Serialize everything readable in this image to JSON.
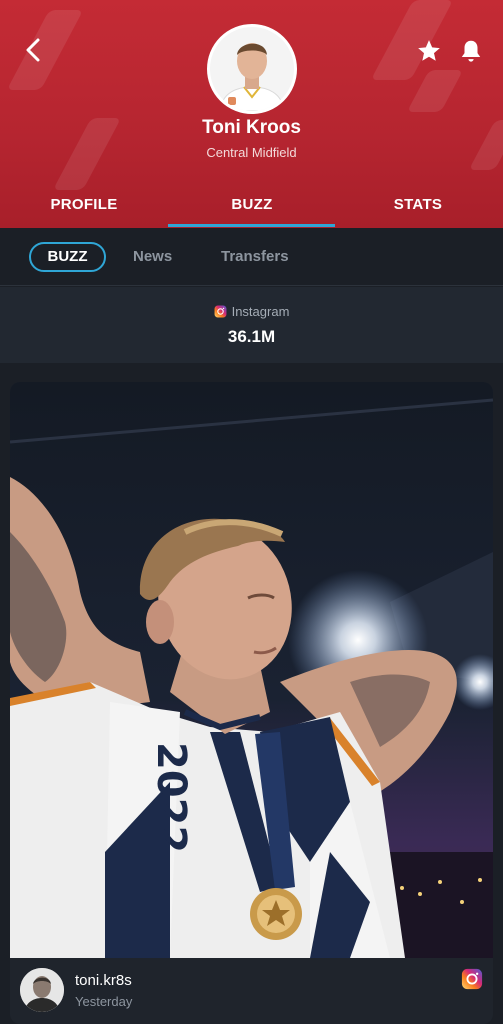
{
  "header": {
    "player_name": "Toni Kroos",
    "position": "Central Midfield",
    "colors": {
      "background": "#c42b35",
      "accent": "#2fa6d6"
    }
  },
  "tabs": [
    {
      "label": "PROFILE"
    },
    {
      "label": "BUZZ"
    },
    {
      "label": "STATS"
    }
  ],
  "active_tab": "BUZZ",
  "subtabs": [
    {
      "label": "BUZZ"
    },
    {
      "label": "News"
    },
    {
      "label": "Transfers"
    }
  ],
  "active_subtab": "BUZZ",
  "social_stat": {
    "platform": "Instagram",
    "followers": "36.1M"
  },
  "post": {
    "username": "toni.kr8s",
    "time": "Yesterday",
    "scarf_text": "2022",
    "source_icon": "instagram-icon"
  },
  "icons": {
    "back": "chevron-left-icon",
    "favorite": "star-icon",
    "notifications": "bell-icon"
  }
}
